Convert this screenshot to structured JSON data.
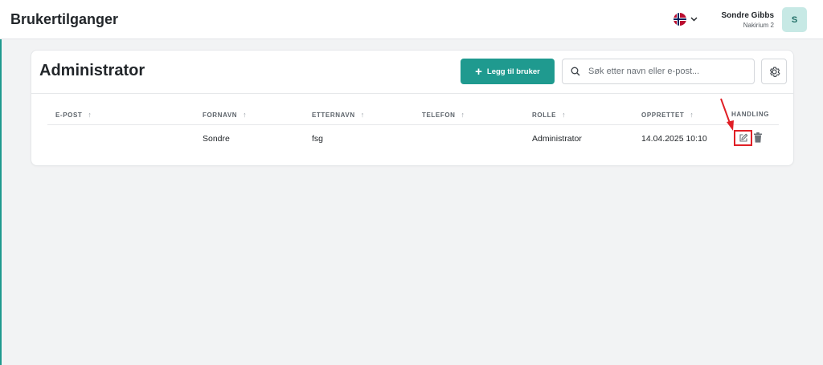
{
  "header": {
    "title": "Brukertilganger",
    "language_flag": "norway-flag-icon",
    "user_name": "Sondre Gibbs",
    "user_org": "Nakirium 2",
    "avatar_initial": "S"
  },
  "card": {
    "title": "Administrator",
    "add_button_label": "Legg til bruker",
    "search_placeholder": "Søk etter navn eller e-post...",
    "settings_icon": "gear-icon"
  },
  "table": {
    "columns": [
      "E-POST",
      "FORNAVN",
      "ETTERNAVN",
      "TELEFON",
      "ROLLE",
      "OPPRETTET",
      "HANDLING"
    ],
    "rows": [
      {
        "epost": "",
        "fornavn": "Sondre",
        "etternavn": "fsg",
        "telefon": "",
        "rolle": "Administrator",
        "opprettet": "14.04.2025 10:10"
      }
    ]
  },
  "colors": {
    "accent": "#1f9a8f",
    "avatar_bg": "#c7e9e5",
    "annotation_red": "#e01f26"
  }
}
